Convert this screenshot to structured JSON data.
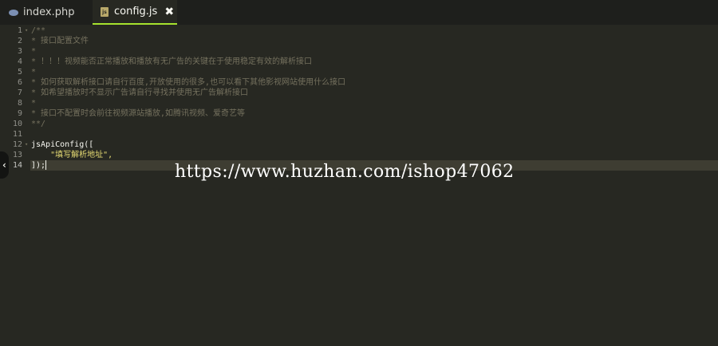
{
  "tabs": [
    {
      "label": "index.php",
      "icon": "php-file-icon"
    },
    {
      "label": "config.js",
      "icon": "js-file-icon",
      "active": true,
      "close": "✖"
    }
  ],
  "editor": {
    "lines": [
      {
        "num": "1",
        "text": "/**",
        "kind": "comment",
        "fold": true
      },
      {
        "num": "2",
        "text": "* 接口配置文件",
        "kind": "comment"
      },
      {
        "num": "3",
        "text": "*",
        "kind": "comment"
      },
      {
        "num": "4",
        "text": "* ！！！视频能否正常播放和播放有无广告的关键在于使用稳定有效的解析接口",
        "kind": "comment"
      },
      {
        "num": "5",
        "text": "*",
        "kind": "comment"
      },
      {
        "num": "6",
        "text": "* 如何获取解析接口请自行百度,开放使用的很多,也可以看下其他影视网站使用什么接口",
        "kind": "comment"
      },
      {
        "num": "7",
        "text": "* 如希望播放时不显示广告请自行寻找并使用无广告解析接口",
        "kind": "comment"
      },
      {
        "num": "8",
        "text": "*",
        "kind": "comment"
      },
      {
        "num": "9",
        "text": "* 接口不配置时会前往视频源站播放,如腾讯视频、爱奇艺等",
        "kind": "comment"
      },
      {
        "num": "10",
        "text": "**/",
        "kind": "comment"
      },
      {
        "num": "11",
        "text": "",
        "kind": "code"
      },
      {
        "num": "12",
        "text": "jsApiConfig([",
        "kind": "code",
        "fold": true
      },
      {
        "num": "13",
        "text": "    \"填写解析地址\",",
        "kind": "string"
      },
      {
        "num": "14",
        "text": "]);",
        "kind": "code",
        "current": true
      }
    ]
  },
  "watermark": "https://www.huzhan.com/ishop47062",
  "collapse_glyph": "‹",
  "fold_glyph": "▾",
  "colors": {
    "background": "#272822",
    "tab_bar": "#1e1f1c",
    "active_tab_underline": "#a6e22e",
    "comment": "#75715e",
    "string": "#e6db74",
    "line_number": "#90908a"
  }
}
